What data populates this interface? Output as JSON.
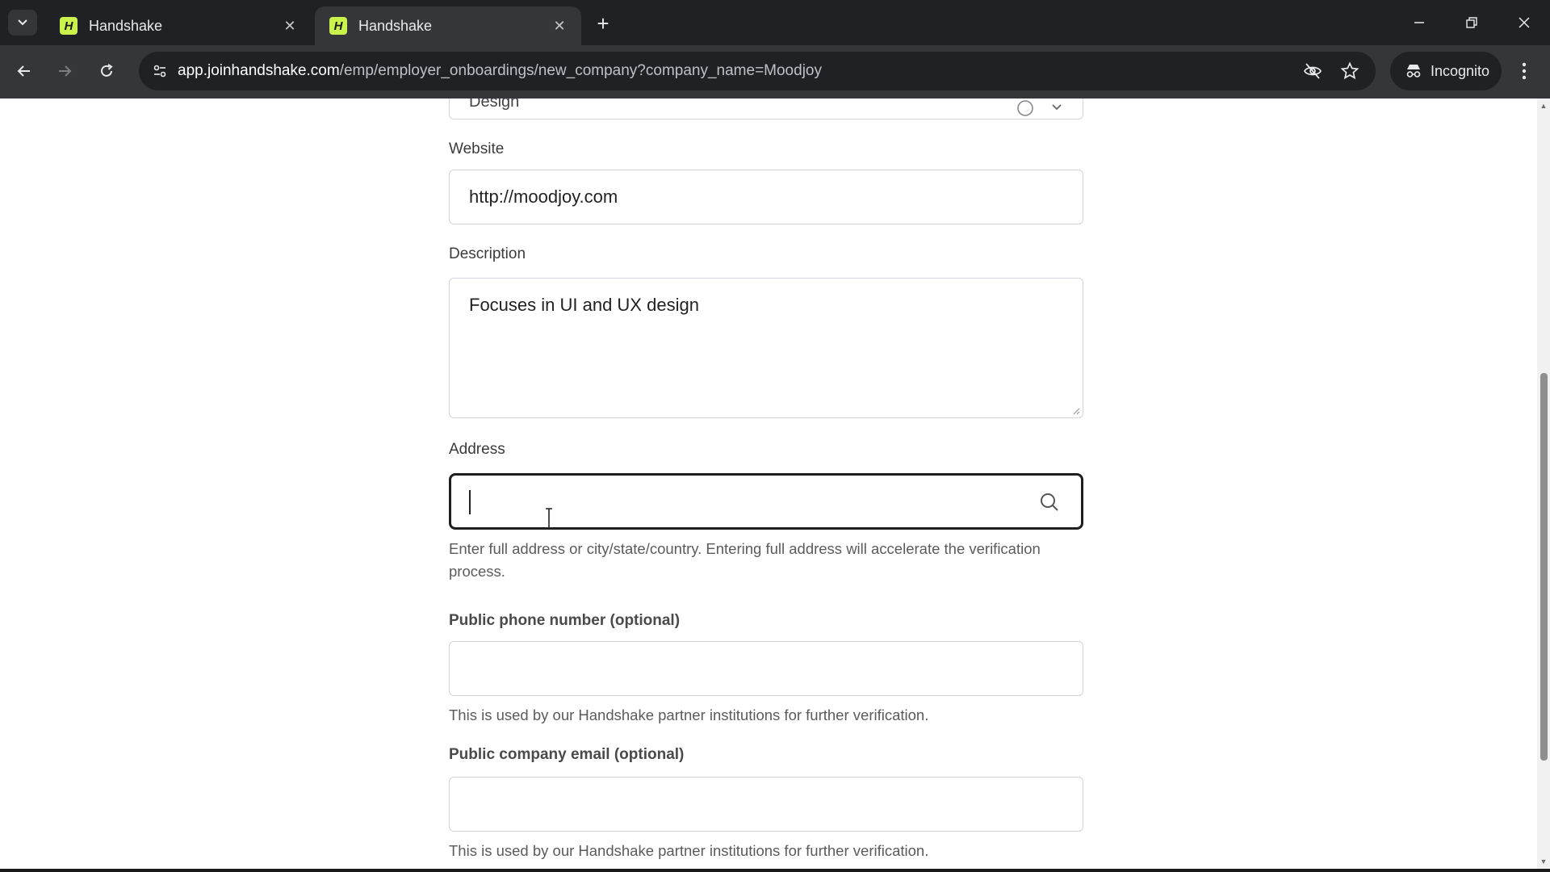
{
  "browser": {
    "tabs": [
      {
        "title": "Handshake",
        "favicon": "H",
        "active": false
      },
      {
        "title": "Handshake",
        "favicon": "H",
        "active": true
      }
    ],
    "url_host": "app.joinhandshake.com",
    "url_path": "/emp/employer_onboardings/new_company?company_name=Moodjoy",
    "incognito_label": "Incognito"
  },
  "form": {
    "industry_partial_value": "Design",
    "website": {
      "label": "Website",
      "value": "http://moodjoy.com"
    },
    "description": {
      "label": "Description",
      "value": "Focuses in UI and UX design"
    },
    "address": {
      "label": "Address",
      "value": "",
      "helper": "Enter full address or city/state/country. Entering full address will accelerate the verification process."
    },
    "phone": {
      "label": "Public phone number (optional)",
      "value": "",
      "helper": "This is used by our Handshake partner institutions for further verification."
    },
    "email": {
      "label": "Public company email (optional)",
      "value": "",
      "helper": "This is used by our Handshake partner institutions for further verification."
    }
  },
  "colors": {
    "chrome_dark": "#202124",
    "chrome_toolbar": "#35363a",
    "favicon_green": "#c9f24c",
    "focus_border": "#1f1f1f"
  }
}
